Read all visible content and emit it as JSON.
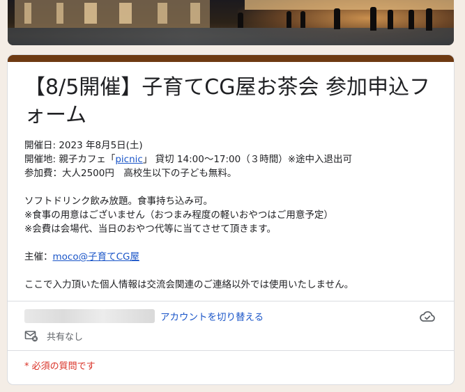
{
  "form": {
    "title": "【8/5開催】子育てCG屋お茶会 参加申込フォーム",
    "description": {
      "date_line": "開催日: 2023 年8月5日(土)",
      "venue_prefix": "開催地: 親子カフェ「",
      "venue_link": "picnic",
      "venue_suffix": "」 貸切 14:00〜17:00（３時間）※途中入退出可",
      "fee_line": "参加費：大人2500円　高校生以下の子ども無料。",
      "drinks_line": "ソフトドリンク飲み放題。食事持ち込み可。",
      "food_note": "※食事の用意はございません（おつまみ程度の軽いおやつはご用意予定）",
      "fee_note": "※会費は会場代、当日のおやつ代等に当てさせて頂きます。",
      "organizer_prefix": "主催：",
      "organizer_link": "moco@子育てCG屋",
      "privacy_line": "ここで入力頂いた個人情報は交流会関連のご連絡以外では使用いたしません。"
    }
  },
  "account": {
    "switch_label": "アカウントを切り替える",
    "share_status": "共有なし"
  },
  "required_note": "* 必須の質問です",
  "icons": {
    "cloud": "cloud-sync-icon",
    "mail": "mail-off-icon"
  },
  "colors": {
    "accent": "#6e3a12",
    "link": "#1a55c8",
    "required": "#d93025",
    "page_bg": "#f4ede6"
  }
}
